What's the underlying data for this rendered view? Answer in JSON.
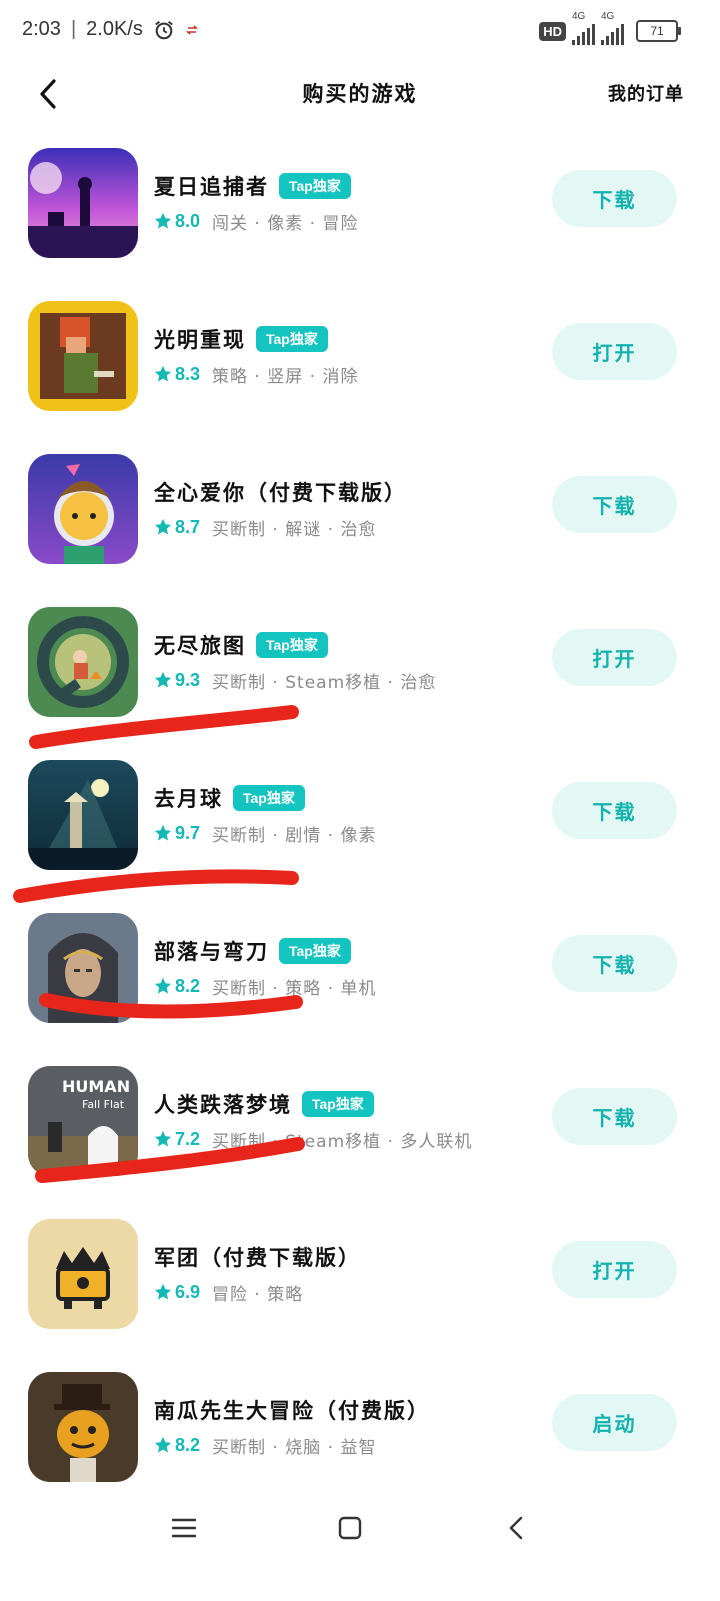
{
  "status_bar": {
    "time": "2:03",
    "network_speed": "2.0K/s",
    "hd_label": "HD",
    "network_type_1": "4G",
    "network_type_2": "4G",
    "battery": "71"
  },
  "header": {
    "title": "购买的游戏",
    "orders_link": "我的订单"
  },
  "games": [
    {
      "name": "夏日追捕者",
      "exclusive": true,
      "badge": "Tap独家",
      "rating": "8.0",
      "tags": "闯关 · 像素 · 冒险",
      "action": "下载"
    },
    {
      "name": "光明重现",
      "exclusive": true,
      "badge": "Tap独家",
      "rating": "8.3",
      "tags": "策略 · 竖屏 · 消除",
      "action": "打开"
    },
    {
      "name": "全心爱你（付费下载版）",
      "exclusive": false,
      "badge": "",
      "rating": "8.7",
      "tags": "买断制 · 解谜 · 治愈",
      "action": "下载"
    },
    {
      "name": "无尽旅图",
      "exclusive": true,
      "badge": "Tap独家",
      "rating": "9.3",
      "tags": "买断制 · Steam移植 · 治愈",
      "action": "打开"
    },
    {
      "name": "去月球",
      "exclusive": true,
      "badge": "Tap独家",
      "rating": "9.7",
      "tags": "买断制 · 剧情 · 像素",
      "action": "下载"
    },
    {
      "name": "部落与弯刀",
      "exclusive": true,
      "badge": "Tap独家",
      "rating": "8.2",
      "tags": "买断制 · 策略 · 单机",
      "action": "下载"
    },
    {
      "name": "人类跌落梦境",
      "exclusive": true,
      "badge": "Tap独家",
      "rating": "7.2",
      "tags": "买断制 · Steam移植 · 多人联机",
      "action": "下载"
    },
    {
      "name": "军团（付费下载版）",
      "exclusive": false,
      "badge": "",
      "rating": "6.9",
      "tags": "冒险 · 策略",
      "action": "打开"
    },
    {
      "name": "南瓜先生大冒险（付费版）",
      "exclusive": false,
      "badge": "",
      "rating": "8.2",
      "tags": "买断制 · 烧脑 · 益智",
      "action": "启动"
    }
  ],
  "icon_art": {
    "human_fall_flat_line1": "HUMAN",
    "human_fall_flat_line2": "Fall Flat"
  },
  "colors": {
    "accent": "#14c4c0",
    "button_bg": "#e3f7f5",
    "button_text": "#12b3ae",
    "annotation_red": "#e8251a"
  },
  "icons": {
    "back": "chevron-left-icon",
    "star": "star-icon",
    "menu": "menu-icon",
    "home": "square-home-icon",
    "nav_back": "chevron-left-icon"
  }
}
